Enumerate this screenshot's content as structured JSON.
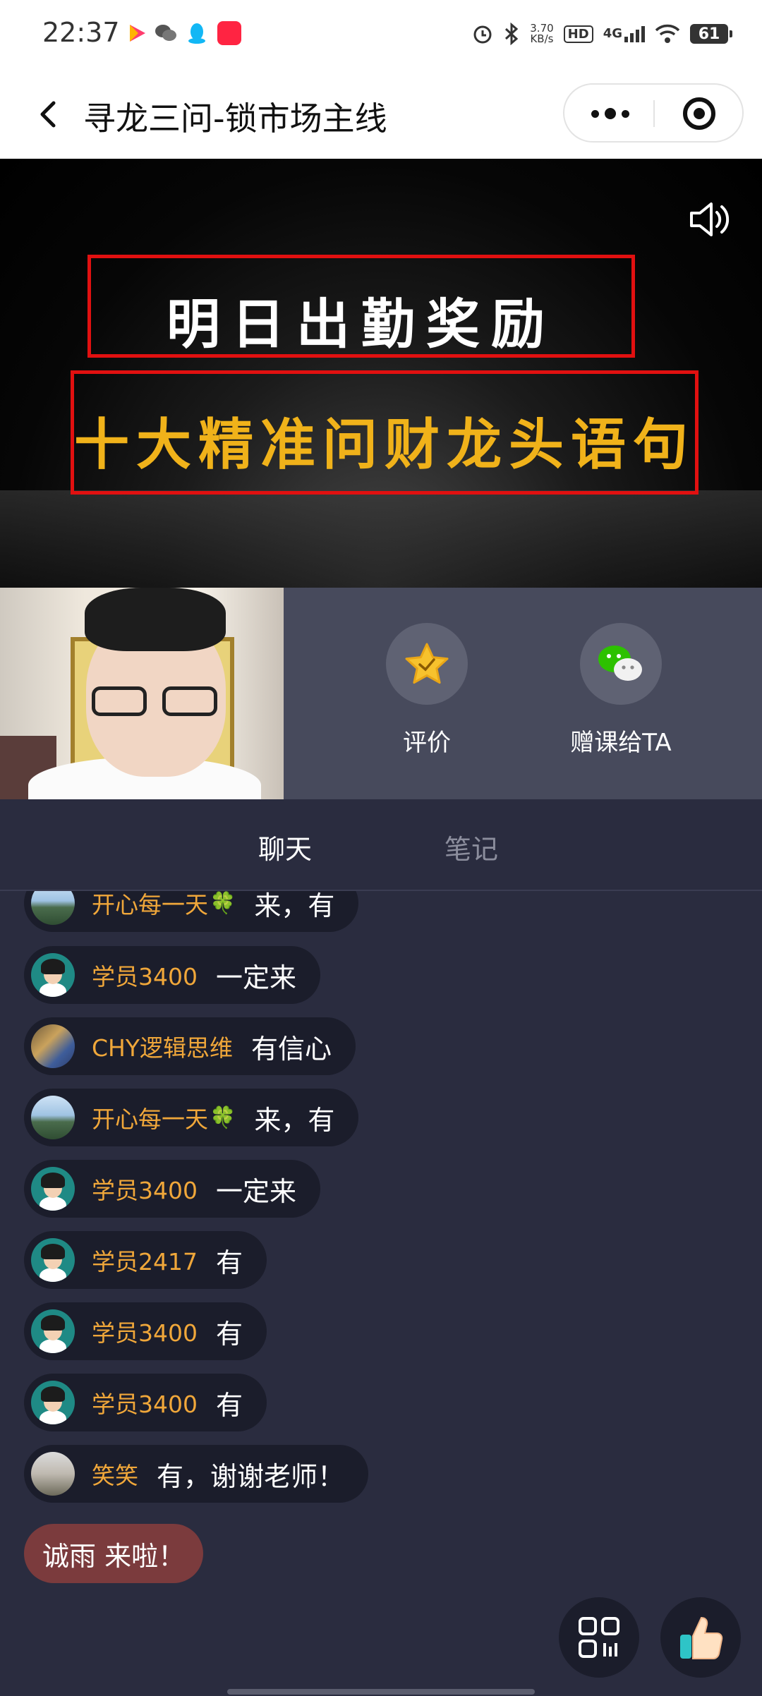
{
  "status_bar": {
    "time": "22:37",
    "network_speed_value": "3.70",
    "network_speed_unit": "KB/s",
    "hd_label": "HD",
    "network_type": "4G",
    "battery": "61"
  },
  "title_bar": {
    "title": "寻龙三问-锁市场主线"
  },
  "video": {
    "line1": "明日出勤奖励",
    "line2": "十大精准问财龙头语句"
  },
  "actions": {
    "rate_label": "评价",
    "gift_label": "赠课给TA"
  },
  "tabs": {
    "chat": "聊天",
    "notes": "笔记"
  },
  "chat": {
    "messages": [
      {
        "name": "开心每一天",
        "suffix": "🍀",
        "text": "来，有",
        "avatar": "lake"
      },
      {
        "name": "学员3400",
        "suffix": "",
        "text": "一定来",
        "avatar": "cartoon"
      },
      {
        "name": "CHY逻辑思维",
        "suffix": "",
        "text": "有信心",
        "avatar": "chy"
      },
      {
        "name": "开心每一天",
        "suffix": "🍀",
        "text": "来，有",
        "avatar": "lake"
      },
      {
        "name": "学员3400",
        "suffix": "",
        "text": "一定来",
        "avatar": "cartoon"
      },
      {
        "name": "学员2417",
        "suffix": "",
        "text": "有",
        "avatar": "cartoon"
      },
      {
        "name": "学员3400",
        "suffix": "",
        "text": "有",
        "avatar": "cartoon"
      },
      {
        "name": "学员3400",
        "suffix": "",
        "text": "有",
        "avatar": "cartoon"
      },
      {
        "name": "笑笑",
        "suffix": "",
        "text": "有，谢谢老师！",
        "avatar": "xiao"
      }
    ],
    "enter_notice": "诚雨 来啦！"
  },
  "colors": {
    "chat_bg": "#2a2c3f",
    "bubble_bg": "#1b1d2b",
    "username": "#f0a73a",
    "red_frame": "#e11010",
    "gold_text": "#f0b21a",
    "enter_notice_bg": "#7b3b3d"
  },
  "icons": [
    "back-arrow-icon",
    "more-dots-icon",
    "close-miniprogram-icon",
    "speaker-icon",
    "star-icon",
    "wechat-icon",
    "qrcode-icon",
    "thumbs-up-icon"
  ]
}
